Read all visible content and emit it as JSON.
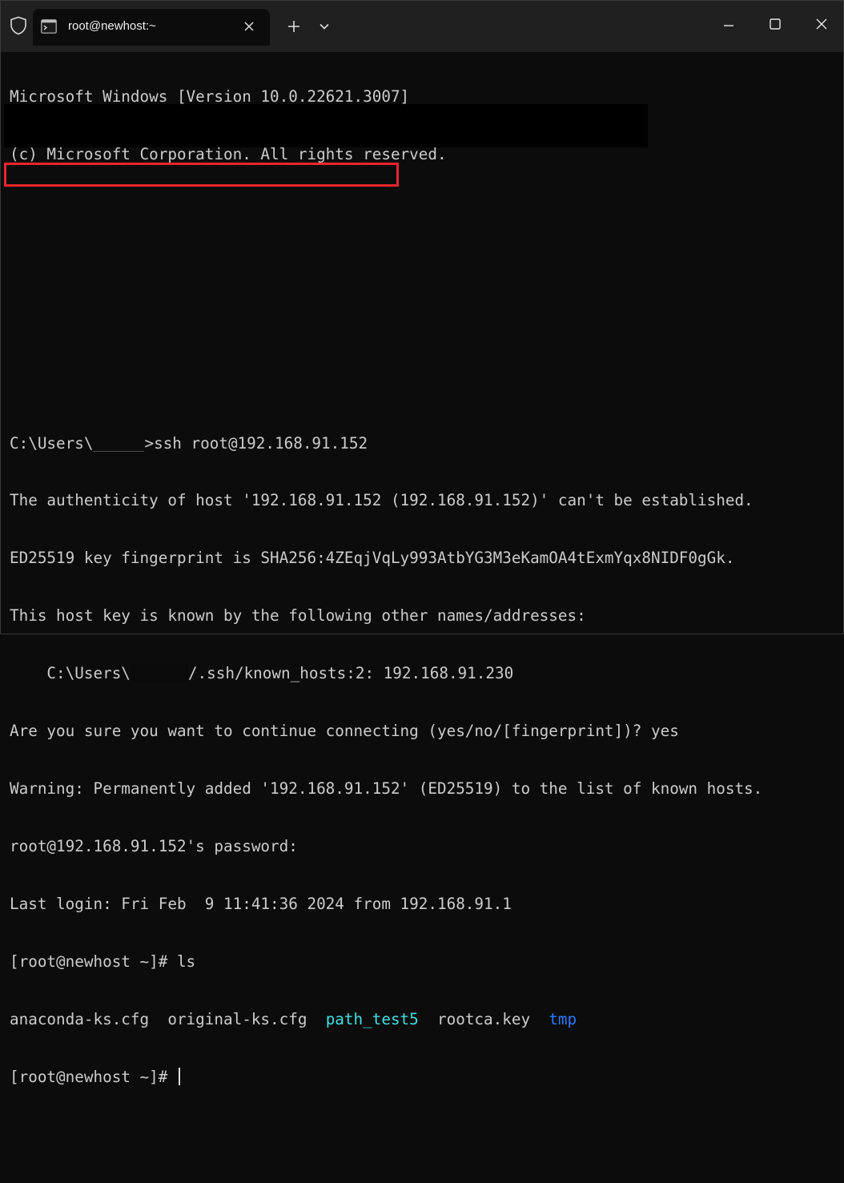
{
  "window": {
    "tab_title": "root@newhost:~",
    "icons": {
      "shield": "shield-icon",
      "tab": "terminal-icon",
      "tab_close": "close-icon",
      "new_tab": "plus-icon",
      "tab_menu": "chevron-down-icon",
      "minimize": "minimize-icon",
      "maximize": "maximize-icon",
      "close": "close-icon"
    }
  },
  "terminal": {
    "line1": "Microsoft Windows [Version 10.0.22621.3007]",
    "line2": "(c) Microsoft Corporation. All rights reserved.",
    "cmd_prefix": "C:\\Users\\",
    "cmd_suffix": ">ssh root@192.168.91.152",
    "auth": "The authenticity of host '192.168.91.152 (192.168.91.152)' can't be established.",
    "fingerprint": "ED25519 key fingerprint is SHA256:4ZEqjVqLy993AtbYG3M3eKamOA4tExmYqx8NIDF0gGk.",
    "known_by": "This host key is known by the following other names/addresses:",
    "known_prefix": "    C:\\Users\\",
    "known_suffix": "/.ssh/known_hosts:2: 192.168.91.230",
    "continue": "Are you sure you want to continue connecting (yes/no/[fingerprint])? yes",
    "warning": "Warning: Permanently added '192.168.91.152' (ED25519) to the list of known hosts.",
    "password": "root@192.168.91.152's password:",
    "last_login": "Last login: Fri Feb  9 11:41:36 2024 from 192.168.91.1",
    "prompt_ls": "[root@newhost ~]# ls",
    "ls_files": {
      "f1": "anaconda-ks.cfg",
      "f2": "original-ks.cfg",
      "f3": "path_test5",
      "f4": "rootca.key",
      "f5": "tmp"
    },
    "prompt_final": "[root@newhost ~]# "
  },
  "colors": {
    "background": "#0c0c0c",
    "text": "#cccccc",
    "directory_cyan": "#3fe0e0",
    "directory_blue": "#2a7bff",
    "highlight": "#e8252e"
  }
}
